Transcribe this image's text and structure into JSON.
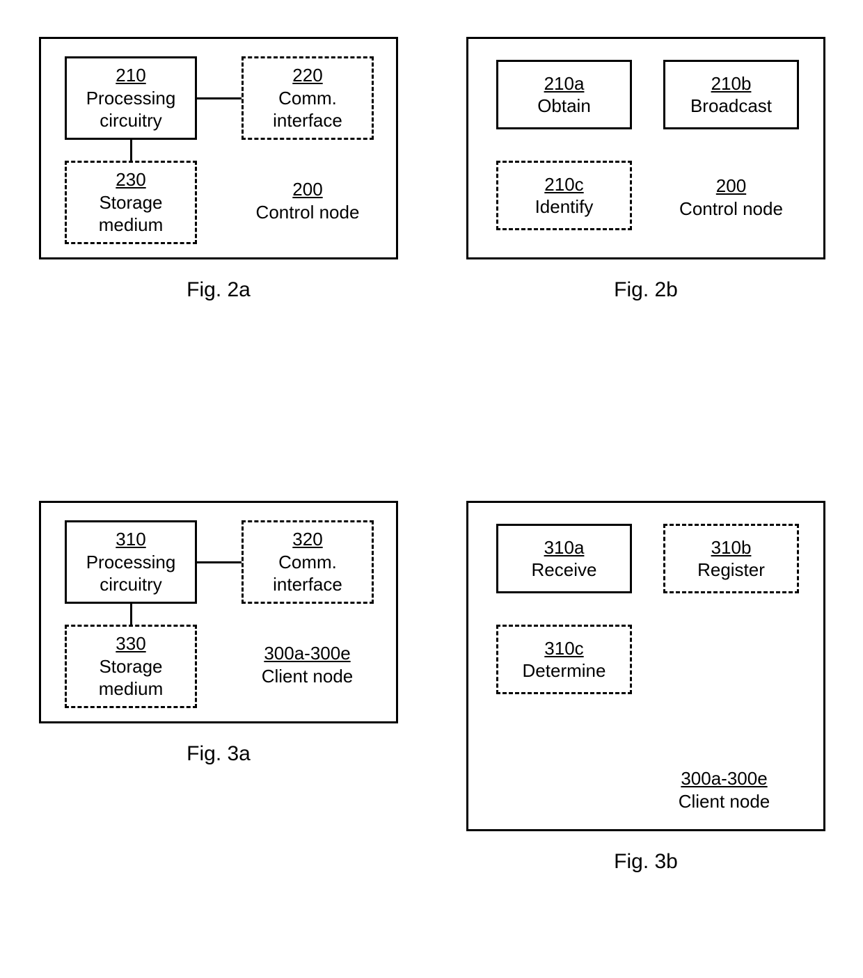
{
  "fig2a": {
    "caption": "Fig. 2a",
    "box210": {
      "ref": "210",
      "label": "Processing\ncircuitry"
    },
    "box220": {
      "ref": "220",
      "label": "Comm.\ninterface"
    },
    "box230": {
      "ref": "230",
      "label": "Storage\nmedium"
    },
    "node": {
      "ref": "200",
      "label": "Control node"
    }
  },
  "fig2b": {
    "caption": "Fig. 2b",
    "box210a": {
      "ref": "210a",
      "label": "Obtain"
    },
    "box210b": {
      "ref": "210b",
      "label": "Broadcast"
    },
    "box210c": {
      "ref": "210c",
      "label": "Identify"
    },
    "node": {
      "ref": "200",
      "label": "Control node"
    }
  },
  "fig3a": {
    "caption": "Fig. 3a",
    "box310": {
      "ref": "310",
      "label": "Processing\ncircuitry"
    },
    "box320": {
      "ref": "320",
      "label": "Comm.\ninterface"
    },
    "box330": {
      "ref": "330",
      "label": "Storage\nmedium"
    },
    "node": {
      "ref": "300a-300e",
      "label": "Client node"
    }
  },
  "fig3b": {
    "caption": "Fig. 3b",
    "box310a": {
      "ref": "310a",
      "label": "Receive"
    },
    "box310b": {
      "ref": "310b",
      "label": "Register"
    },
    "box310c": {
      "ref": "310c",
      "label": "Determine"
    },
    "node": {
      "ref": "300a-300e",
      "label": "Client node"
    }
  }
}
